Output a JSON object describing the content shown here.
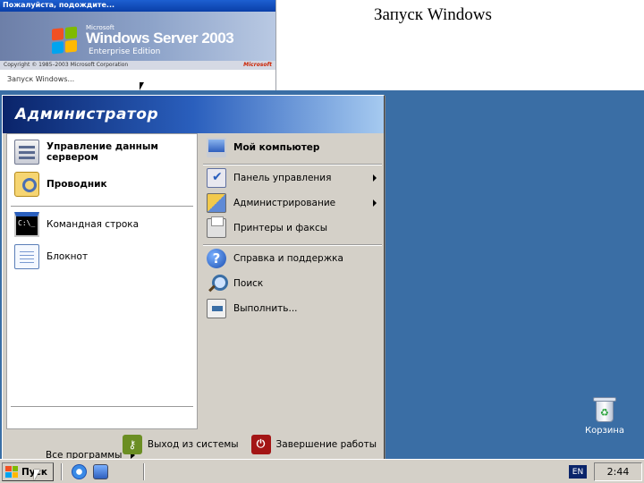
{
  "slide": {
    "title": "Запуск Windows"
  },
  "boot_screen": {
    "titlebar": "Пожалуйста, подождите...",
    "vendor": "Microsoft",
    "product": "Windows Server 2003",
    "edition": "Enterprise Edition",
    "copyright": "Copyright © 1985–2003 Microsoft Corporation",
    "brand": "Microsoft",
    "status": "Запуск Windows...",
    "flag_colors": [
      "#f25022",
      "#7fba00",
      "#00a4ef",
      "#ffb900"
    ]
  },
  "start_menu": {
    "user": "Администратор",
    "pinned": [
      {
        "label": "Управление данным сервером",
        "icon": "server-icon"
      },
      {
        "label": "Проводник",
        "icon": "explorer-icon"
      }
    ],
    "recent": [
      {
        "label": "Командная строка",
        "icon": "cmd-icon",
        "icon_text": "C:\\_"
      },
      {
        "label": "Блокнот",
        "icon": "notepad-icon"
      }
    ],
    "all_programs": "Все программы",
    "right": [
      {
        "label": "Мой компьютер",
        "icon": "computer-icon"
      },
      {
        "label": "Панель управления",
        "icon": "control-panel-icon",
        "submenu": true
      },
      {
        "label": "Администрирование",
        "icon": "admin-tools-icon",
        "submenu": true
      },
      {
        "label": "Принтеры и факсы",
        "icon": "printer-icon"
      },
      {
        "label": "Справка и поддержка",
        "icon": "help-icon",
        "icon_text": "?"
      },
      {
        "label": "Поиск",
        "icon": "search-icon"
      },
      {
        "label": "Выполнить...",
        "icon": "run-icon"
      }
    ],
    "footer": {
      "logoff": "Выход из системы",
      "logoff_icon_text": "⚷",
      "shutdown": "Завершение работы",
      "shutdown_icon_text": "⏻"
    }
  },
  "desktop": {
    "recycle_bin": "Корзина",
    "recycle_icon_text": "♻"
  },
  "taskbar": {
    "start": "Пуск",
    "language": "EN",
    "clock": "2:44"
  },
  "colors": {
    "desktop": "#3a6ea5",
    "menu_header_start": "#0a246a",
    "menu_header_end": "#a6caf0",
    "logoff_icon": "#6b8e23",
    "shutdown_icon": "#a31515"
  }
}
